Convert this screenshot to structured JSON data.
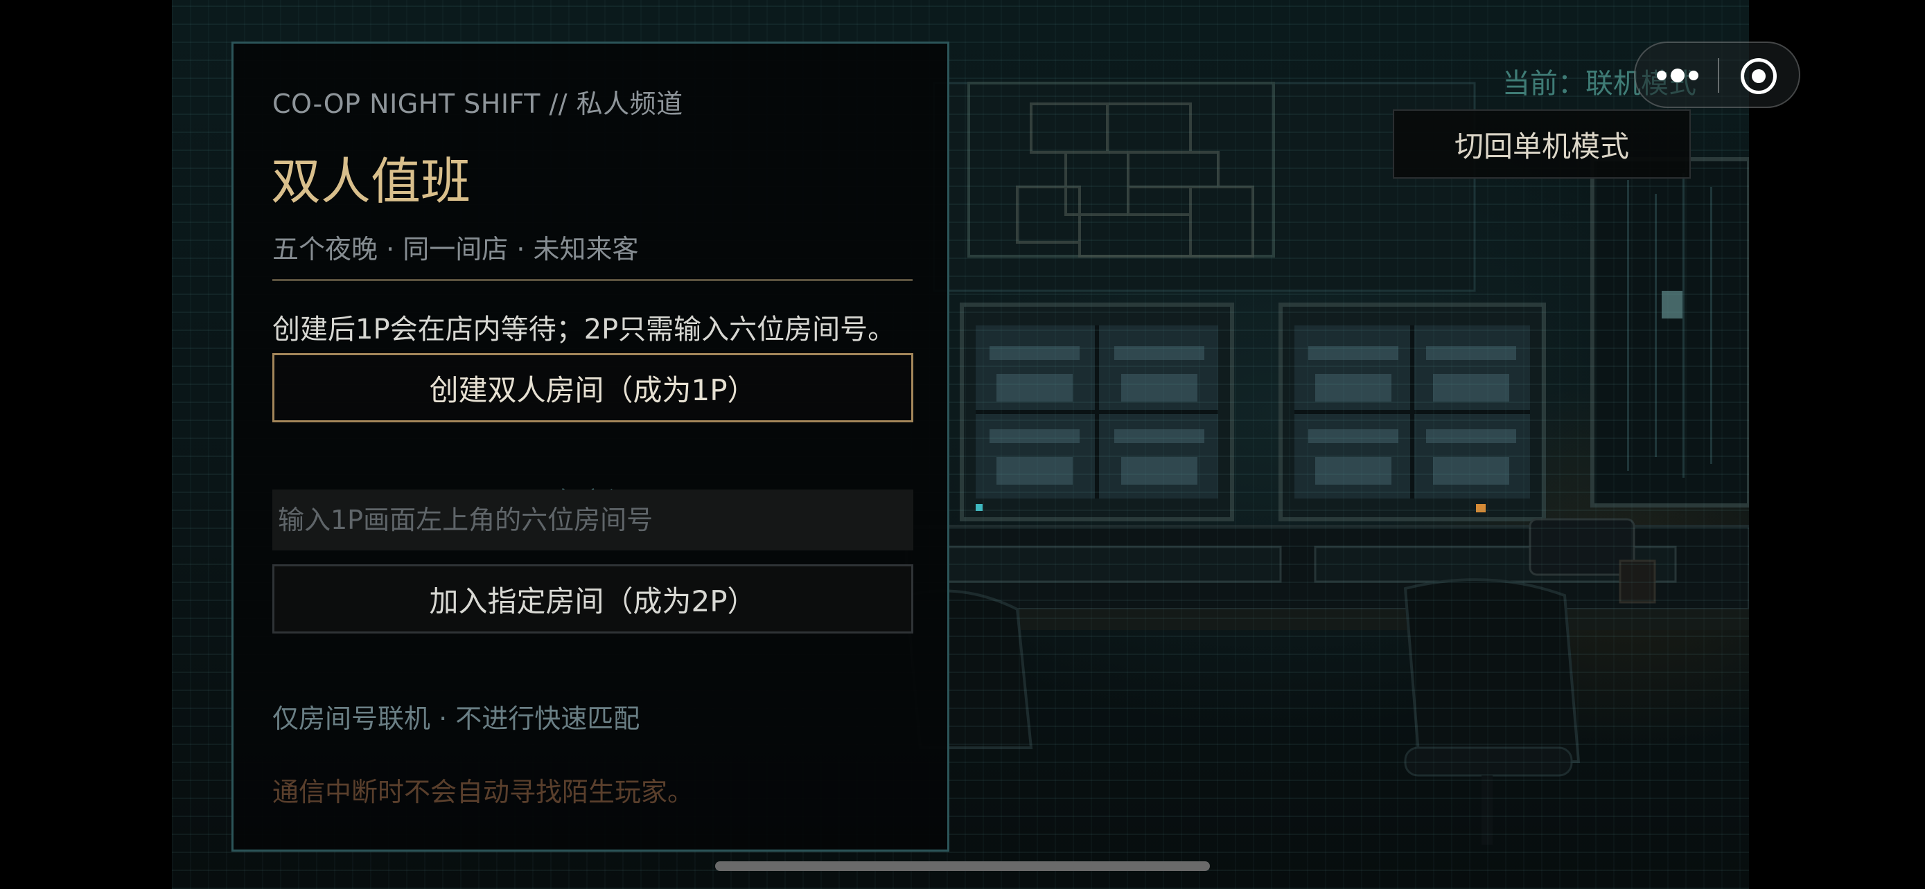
{
  "panel": {
    "eyebrow": "CO-OP NIGHT SHIFT // 私人频道",
    "title": "双人值班",
    "subtitle": "五个夜晚 · 同一间店 · 未知来客",
    "instructions": "创建后1P会在店内等待；2P只需输入六位房间号。",
    "create_button": "创建双人房间（成为1P）",
    "existing_divider": "已有房间号",
    "room_input_placeholder": "输入1P画面左上角的六位房间号",
    "room_input_value": "",
    "join_button": "加入指定房间（成为2P）",
    "note_room_only": "仅房间号联机 · 不进行快速匹配",
    "note_disconnect": "通信中断时不会自动寻找陌生玩家。"
  },
  "topbar": {
    "mode_label": "当前：联机模式",
    "switch_button": "切回单机模式"
  },
  "capsule": {
    "more_icon": "more-dots-icon",
    "close_icon": "target-close-icon"
  },
  "colors": {
    "accent_gold": "#d9bf8c",
    "border_teal": "#2c5559",
    "button_gold_border": "#a3865a",
    "warning_brown": "#5a3f2c"
  }
}
